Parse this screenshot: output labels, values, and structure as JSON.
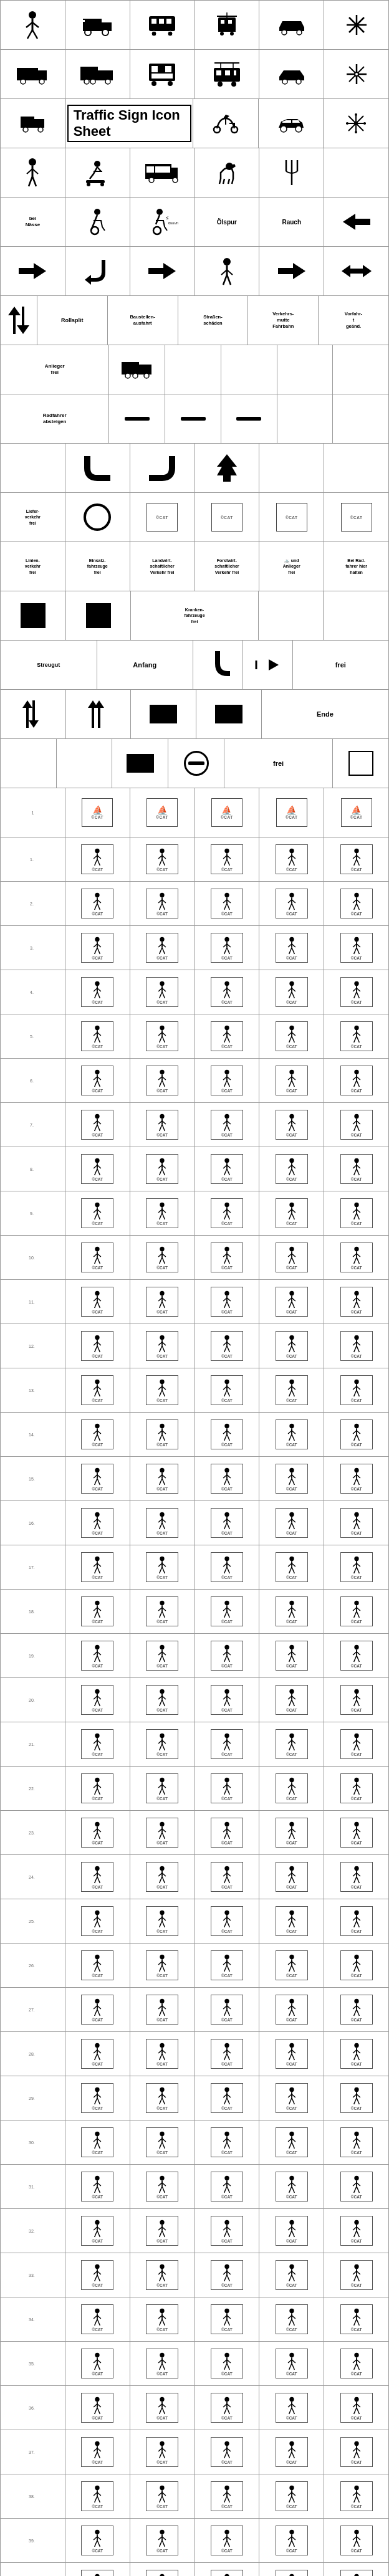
{
  "title": "Traffic Sign Icon Sheet",
  "sections": [
    {
      "id": "section1",
      "rows": [
        {
          "cells": [
            {
              "icon": "person_walk",
              "label": ""
            },
            {
              "icon": "person_run",
              "label": ""
            },
            {
              "icon": "circle_arrow",
              "label": ""
            },
            {
              "icon": "circle_dot",
              "label": ""
            },
            {
              "icon": "circle_x",
              "label": ""
            },
            {
              "icon": "circle_line",
              "label": ""
            }
          ]
        }
      ]
    }
  ],
  "cat_label": "©CAT"
}
